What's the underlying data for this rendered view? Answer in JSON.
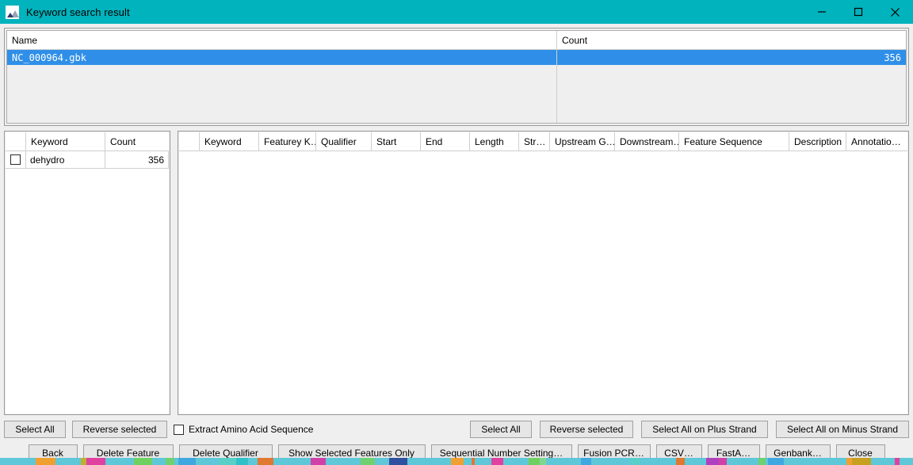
{
  "window": {
    "title": "Keyword search result",
    "icon": "mountain-icon",
    "titlebar_color": "#00b3bd",
    "minimize_label": "—",
    "maximize_label": "□",
    "close_label": "✕"
  },
  "file_table": {
    "columns": [
      "Name",
      "Count"
    ],
    "rows": [
      {
        "name": "NC_000964.gbk",
        "count": "356",
        "selected": true
      }
    ],
    "selection_color": "#2f8fe8"
  },
  "keyword_table": {
    "columns": [
      "",
      "Keyword",
      "Count"
    ],
    "rows": [
      {
        "checked": false,
        "keyword": "dehydro",
        "count": "356"
      }
    ]
  },
  "feature_table": {
    "columns": [
      "",
      "Keyword",
      "Featurey K…",
      "Qualifier",
      "Start",
      "End",
      "Length",
      "Str…",
      "Upstream G…",
      "Downstream…",
      "Feature Sequence",
      "Description",
      "Annotatio…"
    ],
    "rows": []
  },
  "keyword_toolbar": {
    "select_all": "Select All",
    "reverse_selected": "Reverse selected",
    "extract_amino": "Extract Amino Acid Sequence",
    "extract_amino_checked": false
  },
  "feature_toolbar": {
    "select_all": "Select All",
    "reverse_selected": "Reverse selected",
    "select_plus": "Select All on Plus Strand",
    "select_minus": "Select All on Minus Strand"
  },
  "bottom_toolbar": {
    "buttons": [
      "Back",
      "Delete Feature",
      "Delete Qualifier",
      "Show Selected Features Only",
      "Sequential Number Setting…",
      "Fusion PCR…",
      "CSV…",
      "FastA…",
      "Genbank…",
      "Close"
    ]
  },
  "background_strip": {
    "description": "sequence-map-strip",
    "colors": [
      "#5ec8d8",
      "#8fd6a0",
      "#f0a030",
      "#2f3a80",
      "#e040a0",
      "#30c0b0",
      "#6fd060",
      "#c8a020",
      "#40a8e0",
      "#b040c0",
      "#58d0c8",
      "#80d890",
      "#e07830",
      "#3050a0",
      "#d040a8",
      "#2fc0c8",
      "#70d070",
      "#c0b030"
    ]
  }
}
